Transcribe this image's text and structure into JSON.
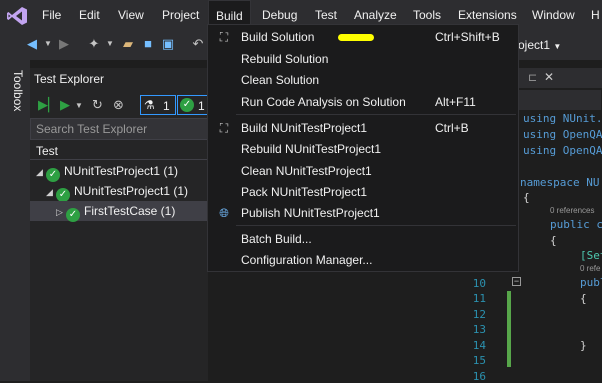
{
  "menubar": {
    "items": [
      "File",
      "Edit",
      "View",
      "Project",
      "Build",
      "Debug",
      "Test",
      "Analyze",
      "Tools",
      "Extensions",
      "Window",
      "H"
    ],
    "project_selector": "roject1"
  },
  "toolbox": {
    "label": "Toolbox"
  },
  "test_explorer": {
    "title": "Test Explorer",
    "flask_count": "1",
    "pass_count": "1",
    "search_placeholder": "Search Test Explorer",
    "column_header": "Test",
    "tree": [
      {
        "label": "NUnitTestProject1 (1)"
      },
      {
        "label": "NUnitTestProject1 (1)"
      },
      {
        "label": "FirstTestCase (1)"
      }
    ]
  },
  "editor": {
    "tab_label": "roject1",
    "lines": [
      {
        "num": "",
        "text": "using NUnit."
      },
      {
        "num": "",
        "text": "using OpenQA"
      },
      {
        "num": "",
        "text": "using OpenQA"
      },
      {
        "num": "",
        "text": "namespace NU"
      },
      {
        "num": "",
        "text": "{"
      },
      {
        "num": "",
        "text": "0 references"
      },
      {
        "num": "",
        "text": "public c"
      },
      {
        "num": "",
        "text": "{"
      },
      {
        "num": "",
        "text": "[Set"
      },
      {
        "num": "",
        "text": "0 refe"
      },
      {
        "num": "",
        "text": "publ"
      },
      {
        "num": "",
        "text": "{"
      },
      {
        "num": "",
        "text": "}"
      }
    ],
    "line_numbers": [
      "10",
      "11",
      "12",
      "13",
      "14",
      "15",
      "16"
    ]
  },
  "build_menu": {
    "items": [
      {
        "label": "Build Solution",
        "shortcut": "Ctrl+Shift+B",
        "icon": "build-icon"
      },
      {
        "label": "Rebuild Solution",
        "shortcut": ""
      },
      {
        "label": "Clean Solution",
        "shortcut": ""
      },
      {
        "label": "Run Code Analysis on Solution",
        "shortcut": "Alt+F11"
      },
      {
        "label": "Build NUnitTestProject1",
        "shortcut": "Ctrl+B",
        "icon": "build-icon"
      },
      {
        "label": "Rebuild NUnitTestProject1",
        "shortcut": ""
      },
      {
        "label": "Clean NUnitTestProject1",
        "shortcut": ""
      },
      {
        "label": "Pack NUnitTestProject1",
        "shortcut": ""
      },
      {
        "label": "Publish NUnitTestProject1",
        "shortcut": "",
        "icon": "globe-icon"
      },
      {
        "label": "Batch Build...",
        "shortcut": ""
      },
      {
        "label": "Configuration Manager...",
        "shortcut": ""
      }
    ]
  },
  "colors": {
    "highlight": "#ffff00",
    "pass": "#2ea043",
    "menu_bg": "#1b1b1c"
  }
}
